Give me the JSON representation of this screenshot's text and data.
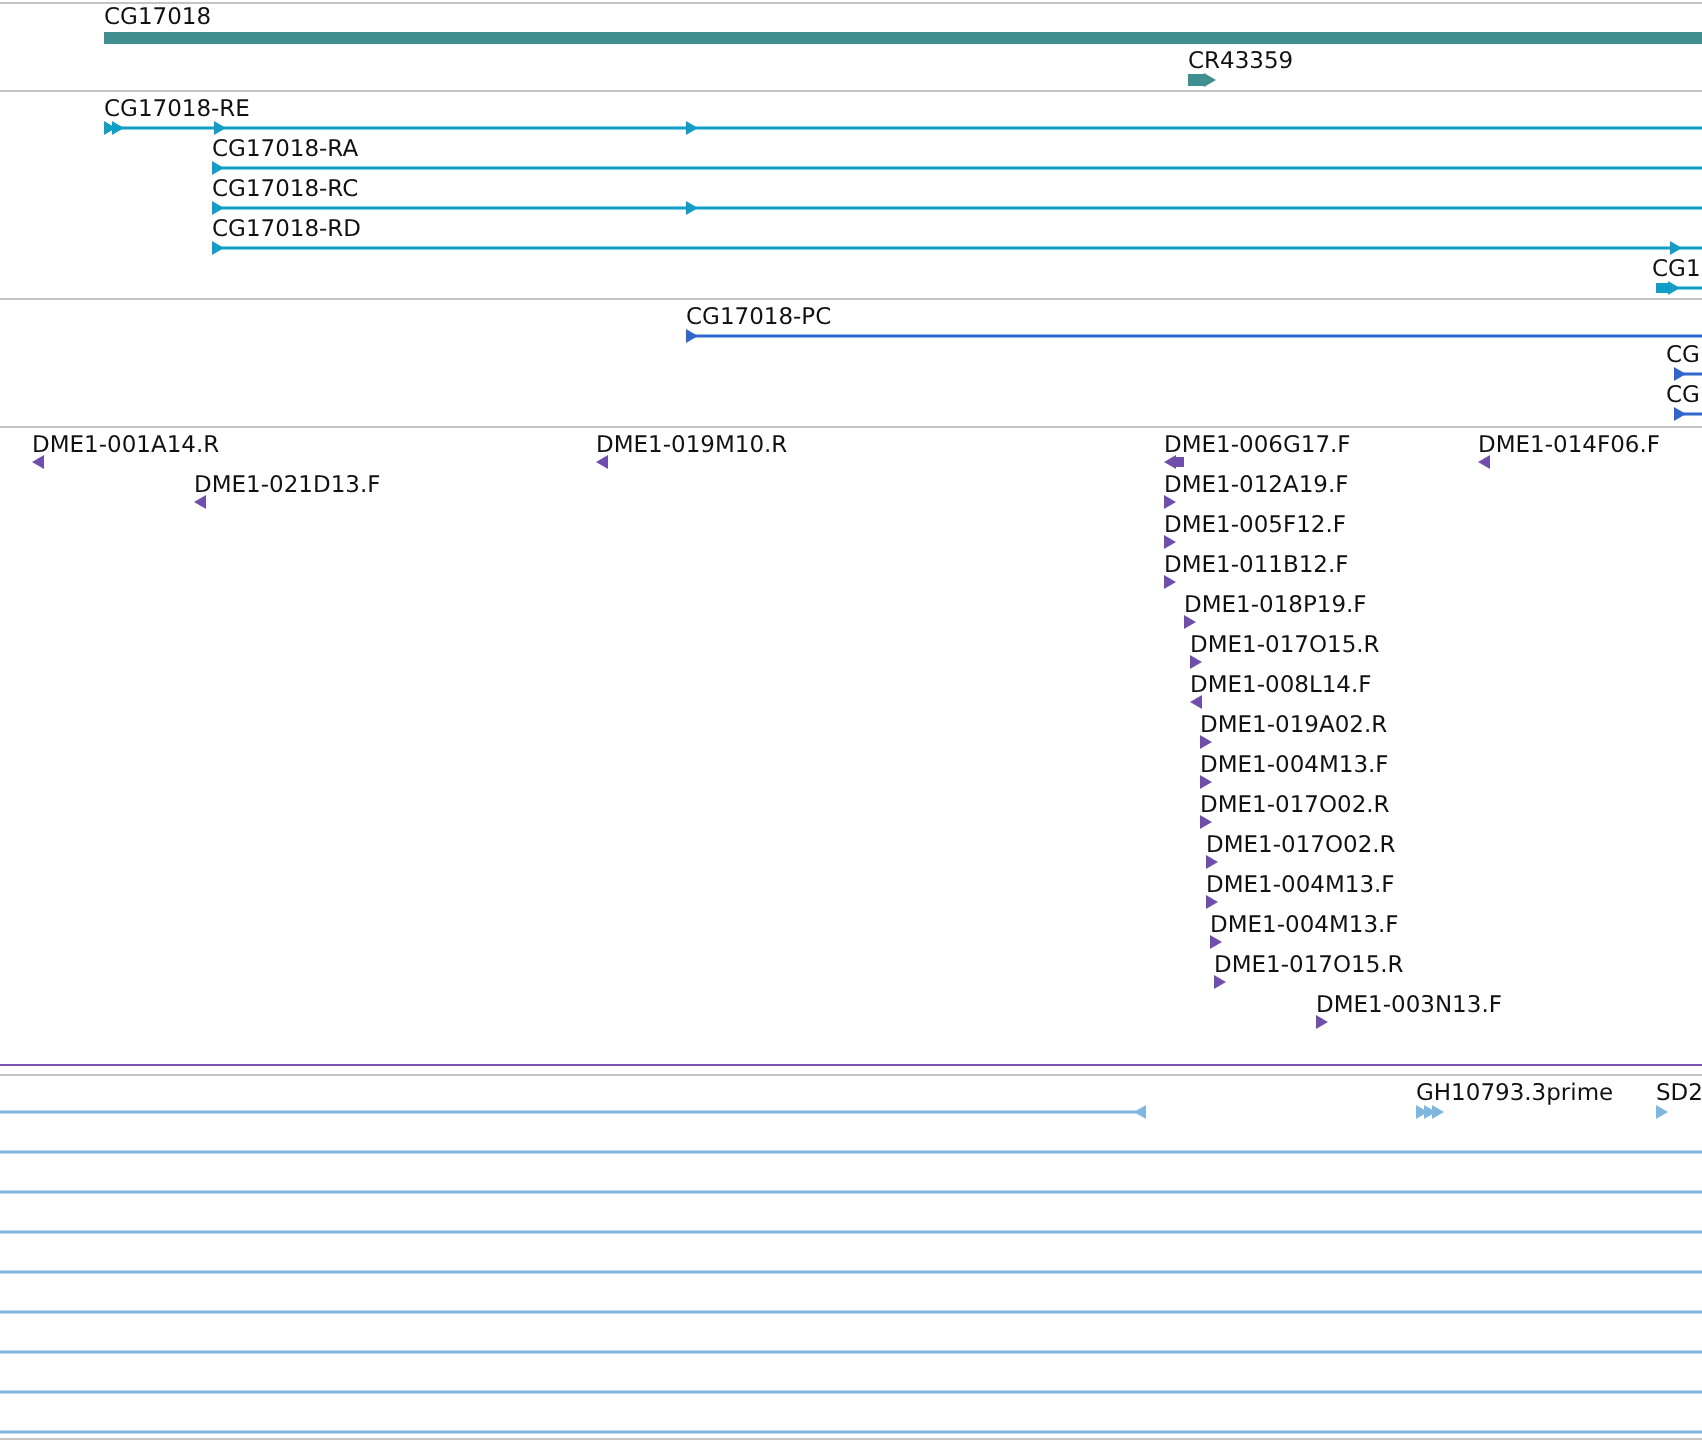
{
  "tracks": [
    {
      "kind": "gene",
      "features": [
        {
          "label": "CG17018"
        },
        {
          "label": "CR43359",
          "reverse": false
        }
      ]
    },
    {
      "kind": "transcript",
      "features": [
        {
          "label": "CG17018-RE",
          "reverse": false
        },
        {
          "label": "CG17018-RA",
          "reverse": false
        },
        {
          "label": "CG17018-RC",
          "reverse": false
        },
        {
          "label": "CG17018-RD",
          "reverse": false
        },
        {
          "label": "CG1",
          "reverse": false
        }
      ]
    },
    {
      "kind": "protein",
      "features": [
        {
          "label": "CG17018-PC",
          "reverse": false
        },
        {
          "label": "CG",
          "reverse": false
        },
        {
          "label": "CG",
          "reverse": false
        }
      ]
    },
    {
      "kind": "clone_end",
      "features": [
        {
          "label": "DME1-001A14.R",
          "reverse": true
        },
        {
          "label": "DME1-021D13.F",
          "reverse": true
        },
        {
          "label": "DME1-019M10.R",
          "reverse": true
        },
        {
          "label": "DME1-006G17.F",
          "reverse": true
        },
        {
          "label": "DME1-014F06.F",
          "reverse": true
        },
        {
          "label": "DME1-012A19.F",
          "reverse": false
        },
        {
          "label": "DME1-005F12.F",
          "reverse": false
        },
        {
          "label": "DME1-011B12.F",
          "reverse": false
        },
        {
          "label": "DME1-018P19.F",
          "reverse": false
        },
        {
          "label": "DME1-017O15.R",
          "reverse": false
        },
        {
          "label": "DME1-008L14.F",
          "reverse": true
        },
        {
          "label": "DME1-019A02.R",
          "reverse": false
        },
        {
          "label": "DME1-004M13.F",
          "reverse": false
        },
        {
          "label": "DME1-017O02.R",
          "reverse": false
        },
        {
          "label": "DME1-017O02.R",
          "reverse": false
        },
        {
          "label": "DME1-004M13.F",
          "reverse": false
        },
        {
          "label": "DME1-004M13.F",
          "reverse": false
        },
        {
          "label": "DME1-017O15.R",
          "reverse": false
        },
        {
          "label": "DME1-003N13.F",
          "reverse": false
        }
      ]
    },
    {
      "kind": "est",
      "features": [
        {
          "kind": "span_end",
          "reverse": true
        },
        {
          "kind": "feature",
          "label": "GH10793.3prime",
          "reverse": false
        },
        {
          "kind": "feature",
          "label": "SD2",
          "reverse": false
        },
        {
          "kind": "span"
        },
        {
          "kind": "span"
        },
        {
          "kind": "span"
        },
        {
          "kind": "span"
        },
        {
          "kind": "span"
        },
        {
          "kind": "span"
        },
        {
          "kind": "span"
        },
        {
          "kind": "span"
        }
      ]
    }
  ]
}
